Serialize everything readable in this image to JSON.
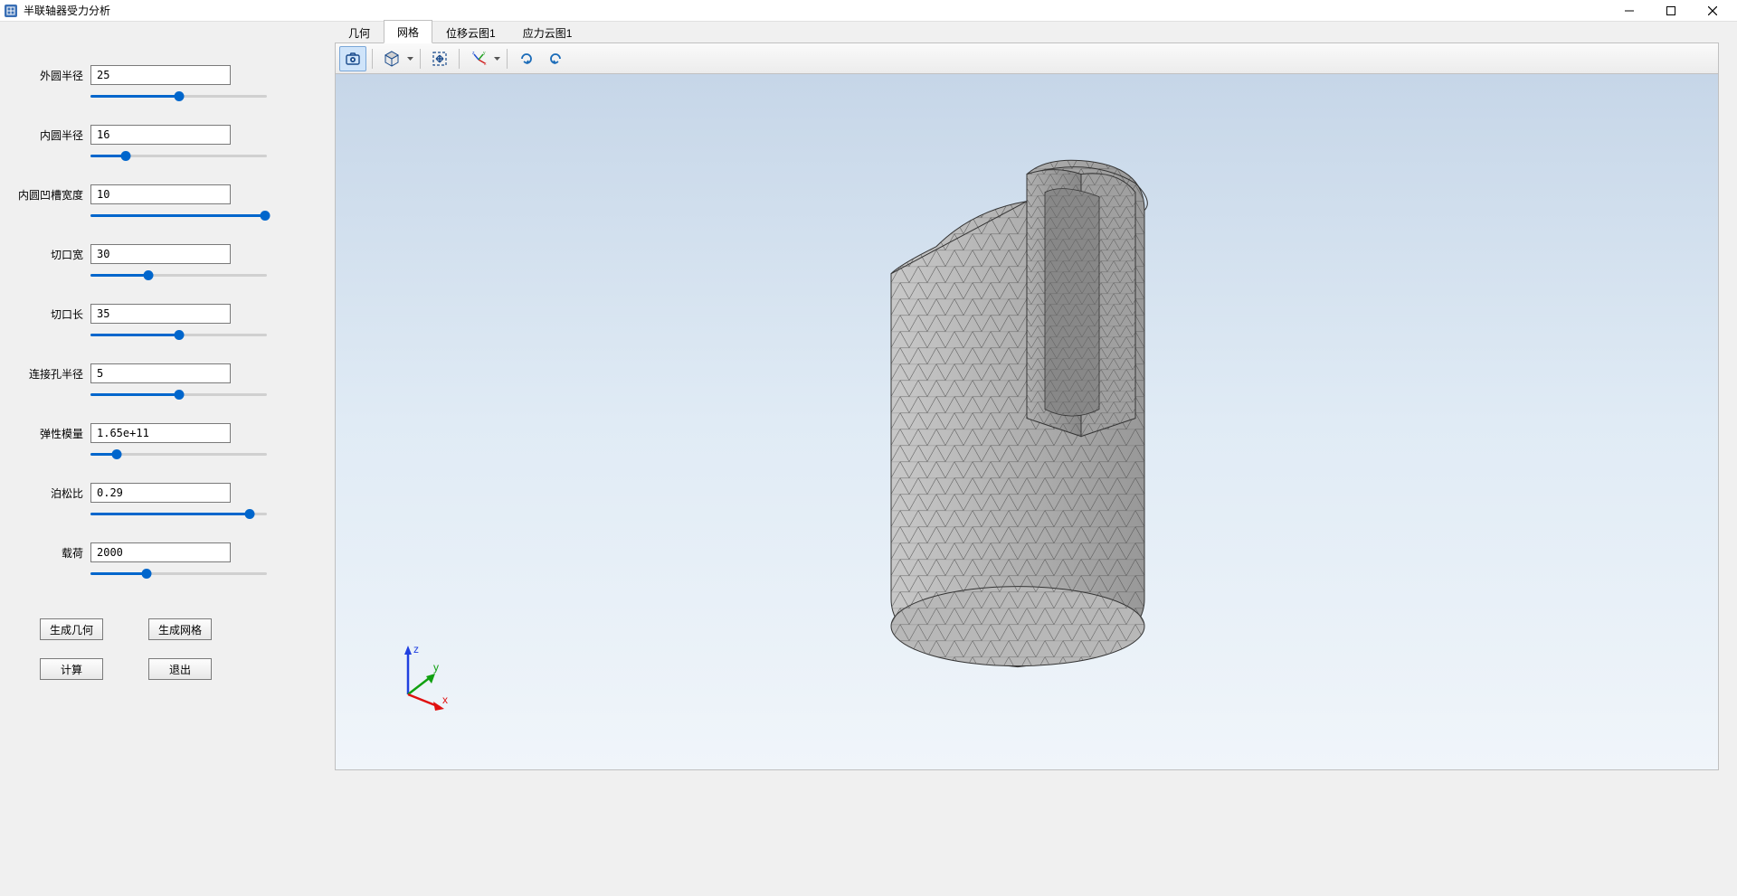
{
  "window": {
    "title": "半联轴器受力分析"
  },
  "params": [
    {
      "label": "外圆半径",
      "value": "25",
      "percent": 50
    },
    {
      "label": "内圆半径",
      "value": "16",
      "percent": 20
    },
    {
      "label": "内圆凹槽宽度",
      "value": "10",
      "percent": 99
    },
    {
      "label": "切口宽",
      "value": "30",
      "percent": 33
    },
    {
      "label": "切口长",
      "value": "35",
      "percent": 50
    },
    {
      "label": "连接孔半径",
      "value": "5",
      "percent": 50
    },
    {
      "label": "弹性模量",
      "value": "1.65e+11",
      "percent": 15
    },
    {
      "label": "泊松比",
      "value": "0.29",
      "percent": 90
    },
    {
      "label": "载荷",
      "value": "2000",
      "percent": 32
    }
  ],
  "buttons": {
    "generate_geometry": "生成几何",
    "generate_mesh": "生成网格",
    "compute": "计算",
    "exit": "退出"
  },
  "tabs": [
    {
      "label": "几何",
      "active": false
    },
    {
      "label": "网格",
      "active": true
    },
    {
      "label": "位移云图1",
      "active": false
    },
    {
      "label": "应力云图1",
      "active": false
    }
  ],
  "axes": {
    "x": "x",
    "y": "y",
    "z": "z"
  }
}
